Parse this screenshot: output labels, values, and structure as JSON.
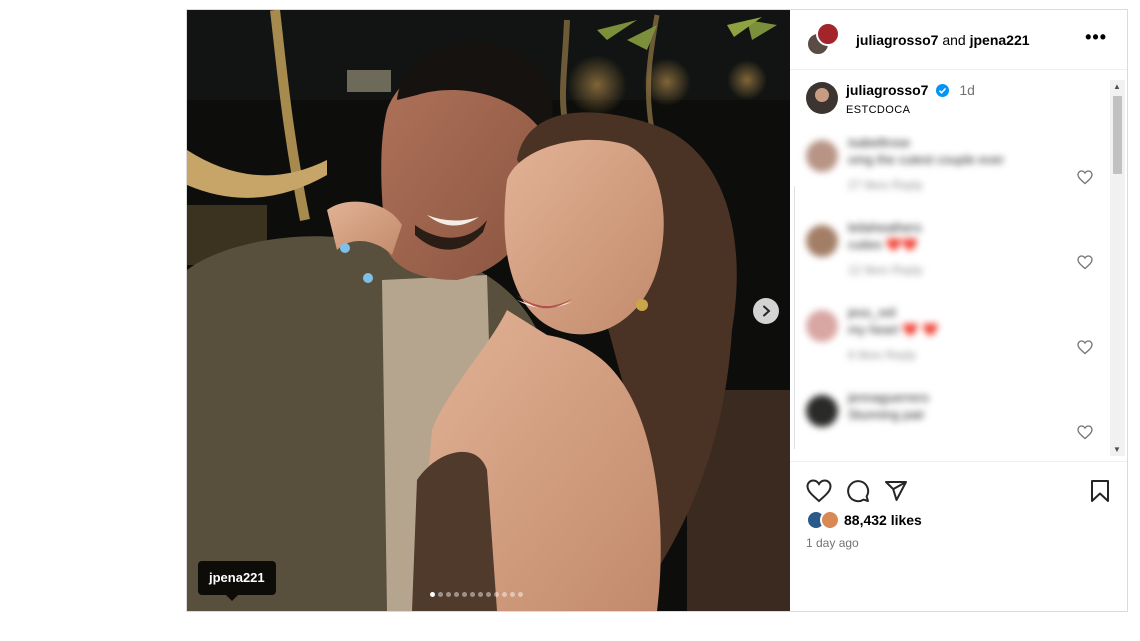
{
  "header": {
    "user1": "juliagrosso7",
    "connector": "and",
    "user2": "jpena221",
    "more_label": "•••"
  },
  "caption": {
    "username": "juliagrosso7",
    "time": "1d",
    "text": "ESTCDOCA"
  },
  "comments": [
    {
      "user": "isabellrose",
      "text": "omg the cutest couple ever",
      "meta": "27 likes   Reply",
      "avatar_color": "#b89485"
    },
    {
      "user": "leilaheathers",
      "text": "cuties ❤️❤️",
      "meta": "12 likes   Reply",
      "avatar_color": "#a37e66"
    },
    {
      "user": "jess_reil",
      "text": "my heart ❤️ ❤️",
      "meta": "6 likes   Reply",
      "avatar_color": "#d9a6a2"
    },
    {
      "user": "jennaguerrero",
      "text": "Stunning pair",
      "meta": "",
      "avatar_color": "#2a2a28"
    }
  ],
  "media": {
    "tag_label": "jpena221",
    "dot_count": 12,
    "active_dot": 0
  },
  "actions": {
    "likes": "88,432 likes",
    "posted": "1 day ago"
  },
  "colors": {
    "verified": "#0095f6",
    "border": "#dbdbdb",
    "muted": "#737373"
  }
}
